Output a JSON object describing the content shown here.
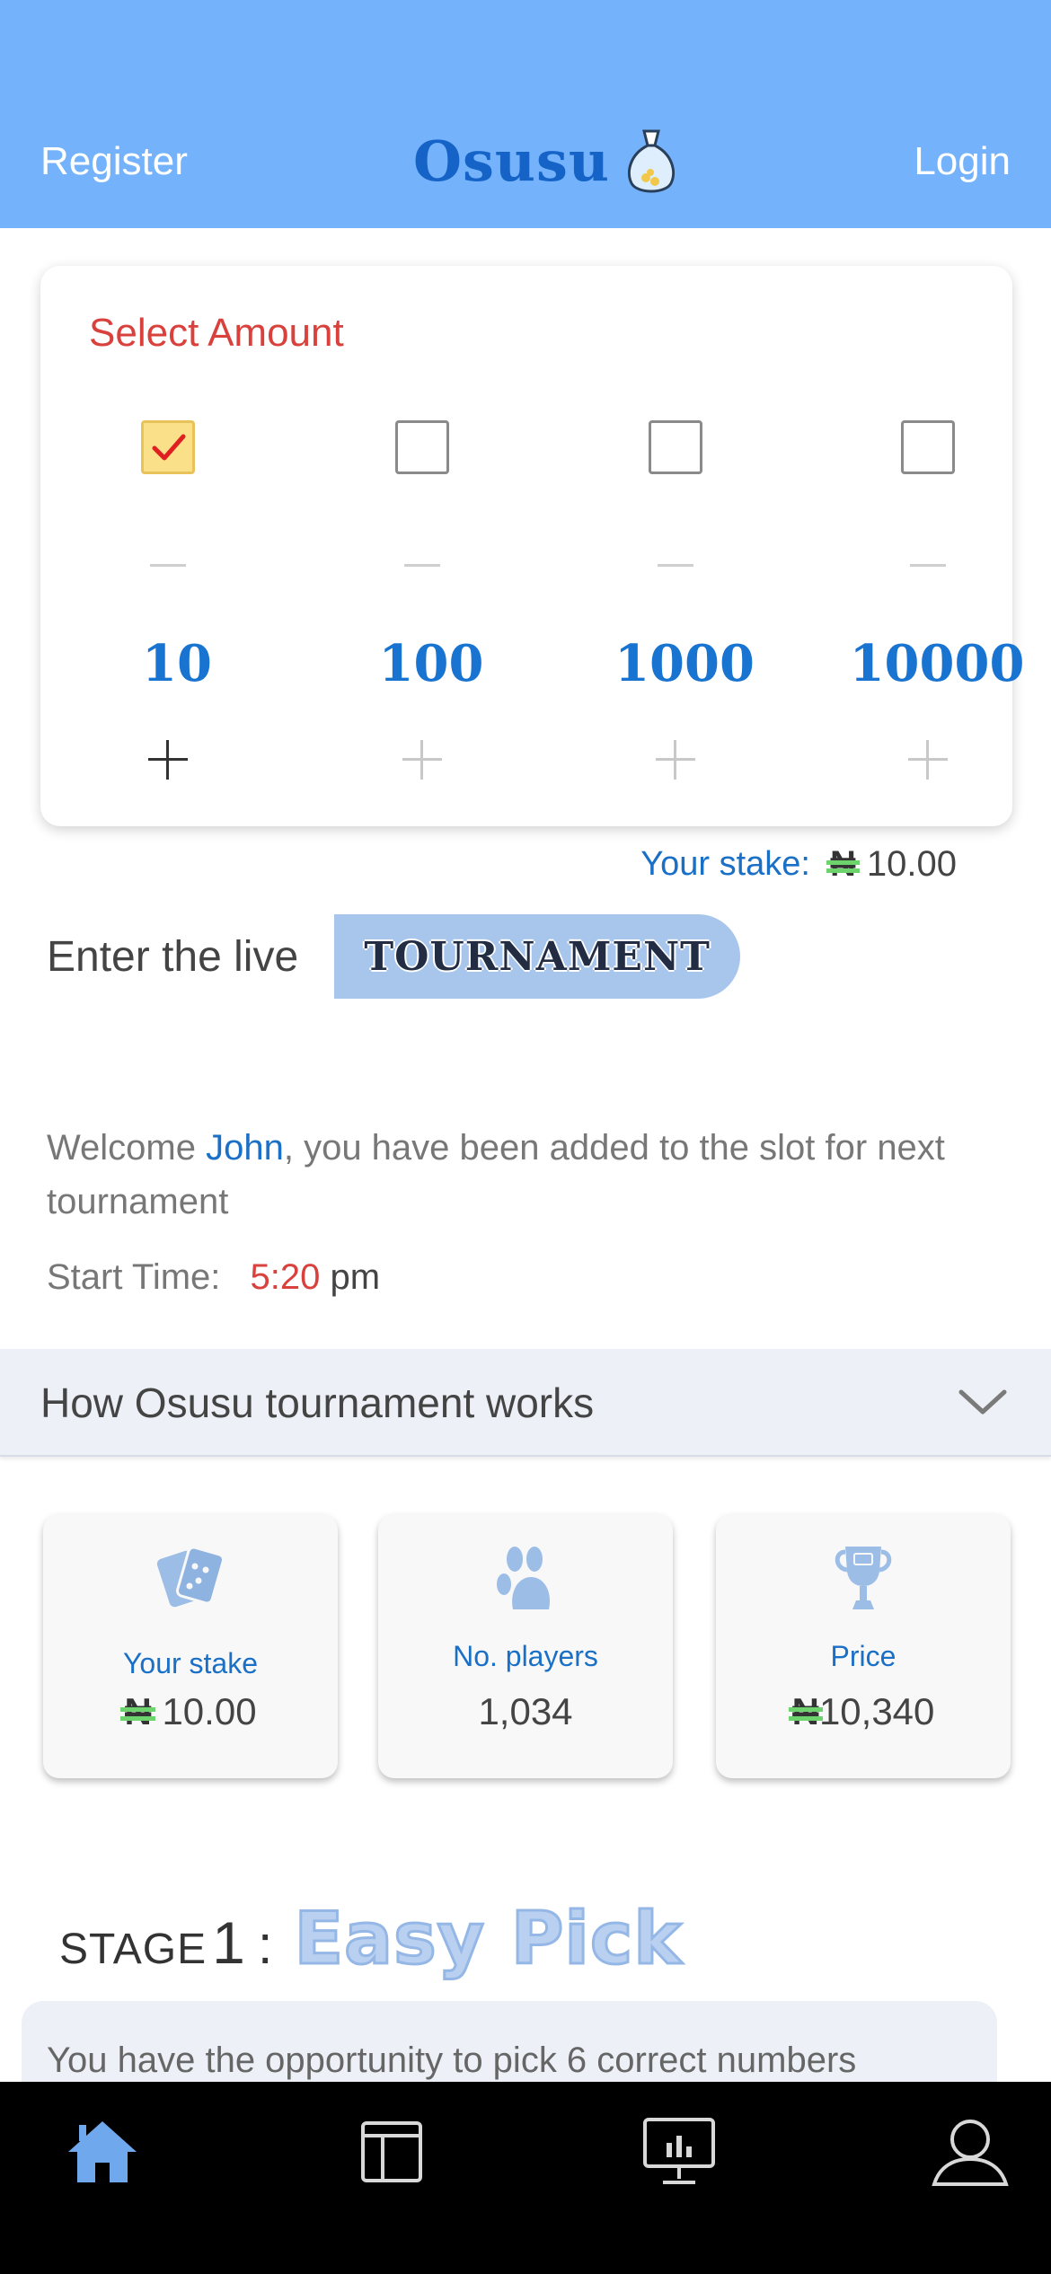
{
  "header": {
    "register_label": "Register",
    "brand_name": "Osusu",
    "login_label": "Login"
  },
  "amount_selector": {
    "title": "Select Amount",
    "options": [
      {
        "value": "10",
        "checked": true
      },
      {
        "value": "100",
        "checked": false
      },
      {
        "value": "1000",
        "checked": false
      },
      {
        "value": "10000",
        "checked": false
      }
    ]
  },
  "stake": {
    "label": "Your stake:",
    "currency_symbol": "₦",
    "amount": "10.00"
  },
  "tournament": {
    "enter_text": "Enter the live",
    "button_label": "TOURNAMENT"
  },
  "welcome": {
    "prefix": "Welcome ",
    "name": "John",
    "suffix": ", you have been added to the slot for next tournament"
  },
  "start_time": {
    "label": "Start Time:",
    "time": "5:20",
    "ampm": "pm"
  },
  "how_it_works": {
    "label": "How Osusu tournament works"
  },
  "stats": [
    {
      "label": "Your stake",
      "currency": "₦",
      "value": "10.00",
      "icon": "cards-icon"
    },
    {
      "label": "No. players",
      "value": "1,034",
      "icon": "players-icon"
    },
    {
      "label": "Price",
      "currency": "₦",
      "value": "10,340",
      "icon": "trophy-icon"
    }
  ],
  "stage": {
    "word": "STAGE",
    "number": "1",
    "colon": ":",
    "title": "Easy Pick",
    "description": "You have the opportunity to pick 6 correct numbers"
  },
  "tabbar": {
    "items": [
      "home-icon",
      "layout-icon",
      "chart-monitor-icon",
      "profile-icon"
    ]
  },
  "colors": {
    "header_bg": "#74b3fb",
    "accent_blue": "#1874d0",
    "alert_red": "#d9413c",
    "checked_bg": "#fbe08a",
    "naira_green": "#6dd36d"
  }
}
